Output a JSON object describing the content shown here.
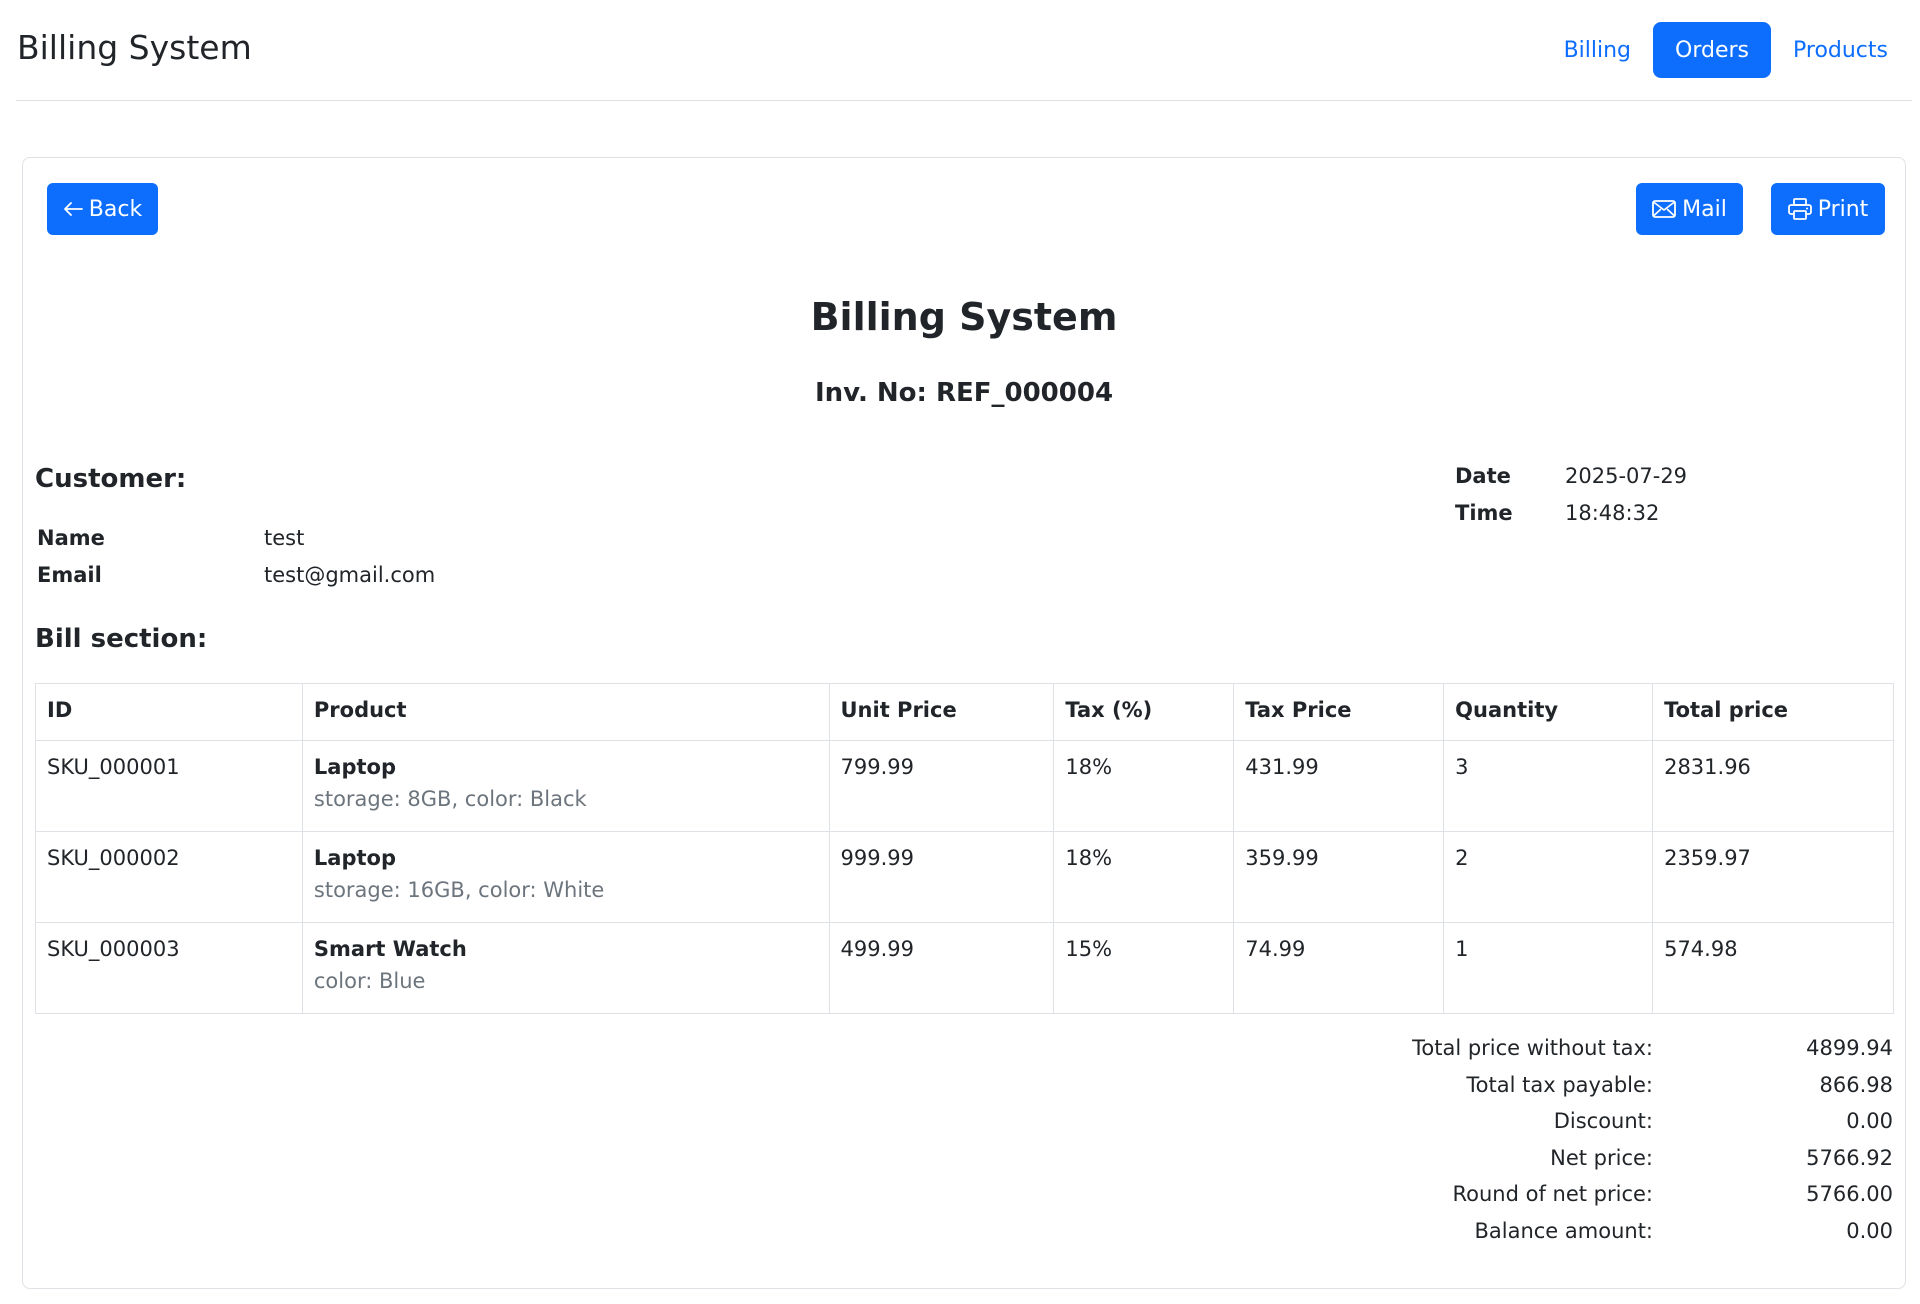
{
  "navbar": {
    "brand": "Billing System",
    "links": [
      {
        "label": "Billing",
        "active": false
      },
      {
        "label": "Orders",
        "active": true
      },
      {
        "label": "Products",
        "active": false
      }
    ]
  },
  "toolbar": {
    "back_label": "Back",
    "back_icon": "arrow-left-icon",
    "mail_label": "Mail",
    "mail_icon": "envelope-icon",
    "print_label": "Print",
    "print_icon": "printer-icon"
  },
  "invoice": {
    "title": "Billing System",
    "number_label": "Inv. No: ",
    "number": "REF_000004"
  },
  "customer": {
    "heading": "Customer:",
    "fields": [
      {
        "label": "Name",
        "value": "test"
      },
      {
        "label": "Email",
        "value": "test@gmail.com"
      }
    ]
  },
  "meta": {
    "fields": [
      {
        "label": "Date",
        "value": "2025-07-29"
      },
      {
        "label": "Time",
        "value": "18:48:32"
      }
    ]
  },
  "bill": {
    "heading": "Bill section:",
    "columns": [
      "ID",
      "Product",
      "Unit Price",
      "Tax (%)",
      "Tax Price",
      "Quantity",
      "Total price"
    ],
    "rows": [
      {
        "id": "SKU_000001",
        "product": "Laptop",
        "attributes": "storage: 8GB, color: Black",
        "unit_price": "799.99",
        "tax_pct": "18%",
        "tax_price": "431.99",
        "quantity": "3",
        "total": "2831.96"
      },
      {
        "id": "SKU_000002",
        "product": "Laptop",
        "attributes": "storage: 16GB, color: White",
        "unit_price": "999.99",
        "tax_pct": "18%",
        "tax_price": "359.99",
        "quantity": "2",
        "total": "2359.97"
      },
      {
        "id": "SKU_000003",
        "product": "Smart Watch",
        "attributes": "color: Blue",
        "unit_price": "499.99",
        "tax_pct": "15%",
        "tax_price": "74.99",
        "quantity": "1",
        "total": "574.98"
      }
    ]
  },
  "totals": [
    {
      "label": "Total price without tax:",
      "value": "4899.94"
    },
    {
      "label": "Total tax payable:",
      "value": "866.98"
    },
    {
      "label": "Discount:",
      "value": "0.00"
    },
    {
      "label": "Net price:",
      "value": "5766.92"
    },
    {
      "label": "Round of net price:",
      "value": "5766.00"
    },
    {
      "label": "Balance amount:",
      "value": "0.00"
    }
  ],
  "colors": {
    "primary": "#0d6efd",
    "muted": "#6c757d",
    "border": "#dee2e6",
    "text": "#212529"
  }
}
